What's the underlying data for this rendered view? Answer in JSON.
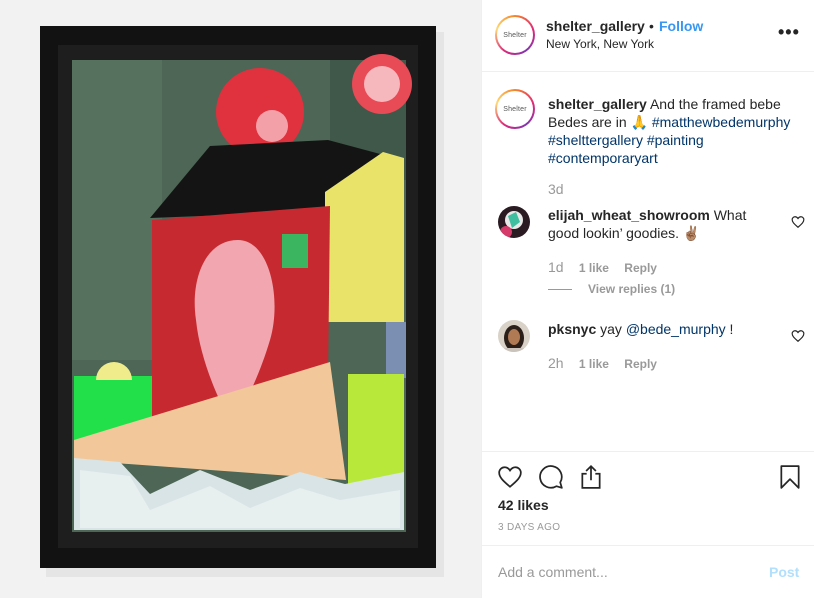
{
  "header": {
    "avatar_text": "Shelter",
    "username": "shelter_gallery",
    "dot": "•",
    "follow_label": "Follow",
    "location": "New York, New York",
    "more_label": "•••"
  },
  "caption": {
    "avatar_text": "Shelter",
    "username": "shelter_gallery",
    "text": "And the framed bebe Bedes are in",
    "emoji": "🙏",
    "hashtags": [
      "#matthewbedemurphy",
      "#shelttergallery",
      "#painting",
      "#contemporaryart"
    ],
    "time": "3d"
  },
  "comments": [
    {
      "username": "elijah_wheat_showroom",
      "text": "What good lookin’ goodies.",
      "emoji": "✌🏽",
      "time": "1d",
      "likes": "1 like",
      "reply_label": "Reply",
      "view_replies": "View replies (1)"
    },
    {
      "username": "pksnyc",
      "text": "yay",
      "mention": "@bede_murphy",
      "text_after": " !",
      "time": "2h",
      "likes": "1 like",
      "reply_label": "Reply"
    }
  ],
  "actions": {
    "icons": [
      "heart-icon",
      "comment-icon",
      "share-icon",
      "bookmark-icon"
    ],
    "likes": "42 likes",
    "date": "3 DAYS AGO"
  },
  "add_comment": {
    "placeholder": "Add a comment...",
    "post_label": "Post"
  },
  "colors": {
    "follow": "#3897f0",
    "link": "#003569",
    "muted": "#999999",
    "post_disabled": "#b2dffc"
  }
}
